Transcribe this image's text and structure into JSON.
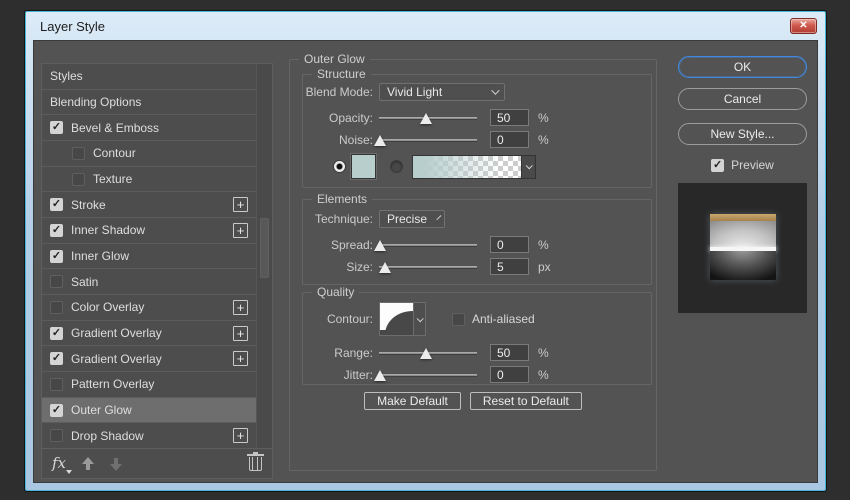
{
  "window": {
    "title": "Layer Style",
    "close_glyph": "✕"
  },
  "sidebar": {
    "items": [
      {
        "label": "Styles",
        "checkbox": "none",
        "plus": false,
        "selected": false,
        "indent": false
      },
      {
        "label": "Blending Options",
        "checkbox": "none",
        "plus": false,
        "selected": false,
        "indent": false
      },
      {
        "label": "Bevel & Emboss",
        "checkbox": "checked",
        "plus": false,
        "selected": false,
        "indent": false
      },
      {
        "label": "Contour",
        "checkbox": "unchecked",
        "plus": false,
        "selected": false,
        "indent": true
      },
      {
        "label": "Texture",
        "checkbox": "unchecked",
        "plus": false,
        "selected": false,
        "indent": true
      },
      {
        "label": "Stroke",
        "checkbox": "checked",
        "plus": true,
        "selected": false,
        "indent": false
      },
      {
        "label": "Inner Shadow",
        "checkbox": "checked",
        "plus": true,
        "selected": false,
        "indent": false
      },
      {
        "label": "Inner Glow",
        "checkbox": "checked",
        "plus": false,
        "selected": false,
        "indent": false
      },
      {
        "label": "Satin",
        "checkbox": "unchecked",
        "plus": false,
        "selected": false,
        "indent": false
      },
      {
        "label": "Color Overlay",
        "checkbox": "unchecked",
        "plus": true,
        "selected": false,
        "indent": false
      },
      {
        "label": "Gradient Overlay",
        "checkbox": "checked",
        "plus": true,
        "selected": false,
        "indent": false
      },
      {
        "label": "Gradient Overlay",
        "checkbox": "checked",
        "plus": true,
        "selected": false,
        "indent": false
      },
      {
        "label": "Pattern Overlay",
        "checkbox": "unchecked",
        "plus": false,
        "selected": false,
        "indent": false
      },
      {
        "label": "Outer Glow",
        "checkbox": "checked",
        "plus": false,
        "selected": true,
        "indent": false
      },
      {
        "label": "Drop Shadow",
        "checkbox": "unchecked",
        "plus": true,
        "selected": false,
        "indent": false
      }
    ],
    "footer": {
      "fx_label": "fx"
    }
  },
  "panel": {
    "title": "Outer Glow",
    "structure": {
      "legend": "Structure",
      "blend_mode": {
        "label": "Blend Mode:",
        "value": "Vivid Light"
      },
      "opacity": {
        "label": "Opacity:",
        "value": "50",
        "unit": "%",
        "pos": 48
      },
      "noise": {
        "label": "Noise:",
        "value": "0",
        "unit": "%",
        "pos": 1
      },
      "color_selected": "solid",
      "swatch_color": "#b7cecd"
    },
    "elements": {
      "legend": "Elements",
      "technique": {
        "label": "Technique:",
        "value": "Precise"
      },
      "spread": {
        "label": "Spread:",
        "value": "0",
        "unit": "%",
        "pos": 1
      },
      "size": {
        "label": "Size:",
        "value": "5",
        "unit": "px",
        "pos": 6
      }
    },
    "quality": {
      "legend": "Quality",
      "contour_label": "Contour:",
      "anti_aliased": {
        "label": "Anti-aliased",
        "checked": false
      },
      "range": {
        "label": "Range:",
        "value": "50",
        "unit": "%",
        "pos": 48
      },
      "jitter": {
        "label": "Jitter:",
        "value": "0",
        "unit": "%",
        "pos": 1
      }
    },
    "footer_buttons": {
      "make_default": "Make Default",
      "reset_default": "Reset to Default"
    }
  },
  "actions": {
    "ok": "OK",
    "cancel": "Cancel",
    "new_style": "New Style...",
    "preview": {
      "label": "Preview",
      "checked": true
    }
  },
  "colors": {
    "accent_blue": "#3f8ae0",
    "glow_color": "#b7cecd",
    "title_bar": "#b2cde6"
  }
}
